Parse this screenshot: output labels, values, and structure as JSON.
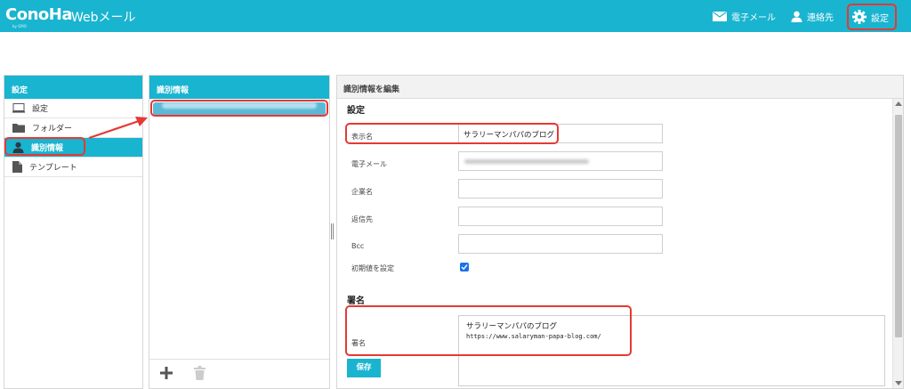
{
  "header": {
    "logo": "ConoHa",
    "logo_sub": "by GMO",
    "app_name": "Webメール",
    "mail_label": "電子メール",
    "contacts_label": "連絡先",
    "settings_label": "設定"
  },
  "left_panel": {
    "title": "設定",
    "items": [
      {
        "label": "設定",
        "icon": "monitor-icon"
      },
      {
        "label": "フォルダー",
        "icon": "folder-icon"
      },
      {
        "label": "識別情報",
        "icon": "person-icon"
      },
      {
        "label": "テンプレート",
        "icon": "document-icon"
      }
    ]
  },
  "mid_panel": {
    "title": "識別情報"
  },
  "right_panel": {
    "title": "識別情報を編集",
    "section_settings": "設定",
    "display_name_label": "表示名",
    "display_name_value": "サラリーマンパパのブログ",
    "email_label": "電子メール",
    "company_label": "企業名",
    "reply_to_label": "返信先",
    "bcc_label": "Bcc",
    "default_label": "初期値を設定",
    "default_checked": true,
    "section_signature": "署名",
    "signature_label": "署名",
    "signature_line1": "サラリーマンパパのブログ",
    "signature_line2": "https://www.salaryman-papa-blog.com/",
    "save_label": "保存"
  },
  "colors": {
    "accent": "#19b4d0",
    "highlight": "#e53935"
  }
}
